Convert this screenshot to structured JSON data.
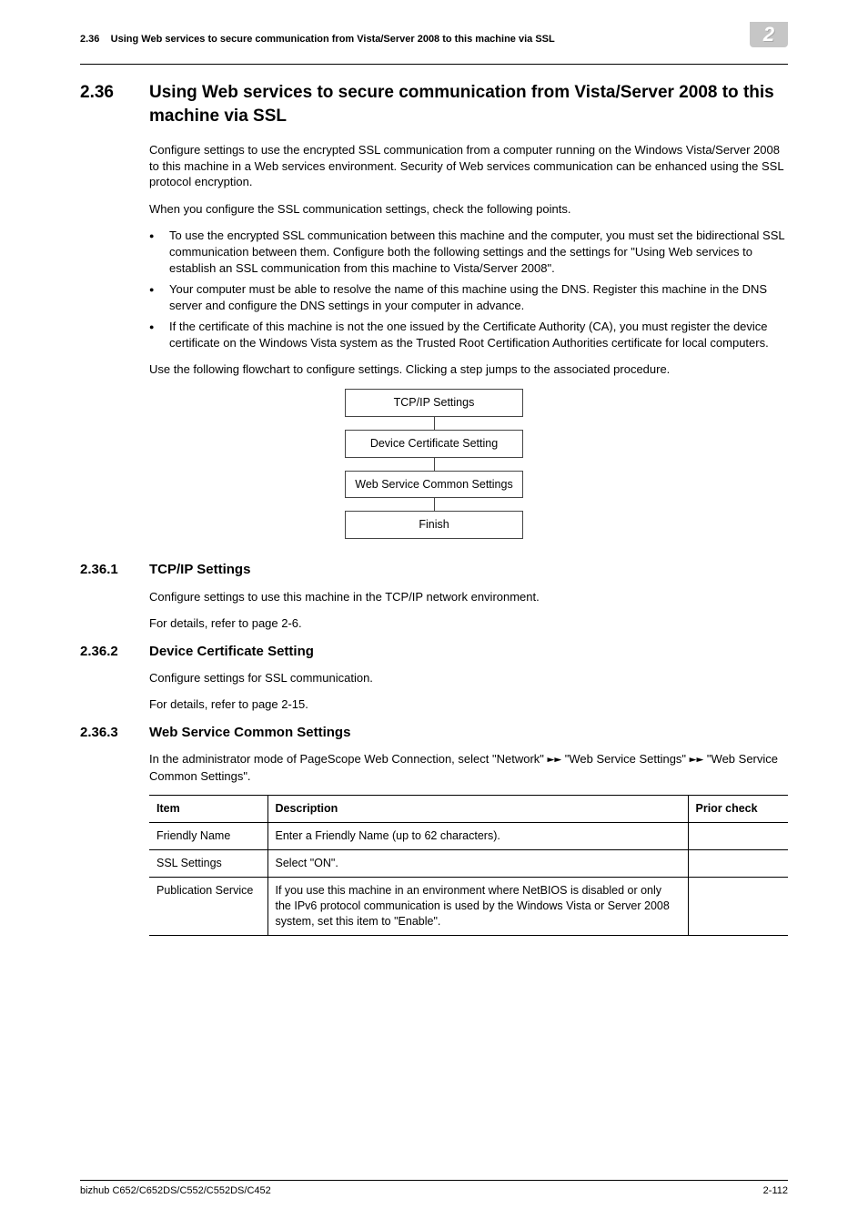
{
  "running_head": {
    "section_num": "2.36",
    "title": "Using Web services to secure communication from Vista/Server 2008 to this machine via SSL",
    "chapter": "2"
  },
  "h1": {
    "num": "2.36",
    "title": "Using Web services to secure communication from Vista/Server 2008 to this machine via SSL"
  },
  "intro_p1": "Configure settings to use the encrypted SSL communication from a computer running on the Windows Vista/Server 2008 to this machine in a Web services environment. Security of Web services communication can be enhanced using the SSL protocol encryption.",
  "intro_p2": "When you configure the SSL communication settings, check the following points.",
  "bullets": [
    "To use the encrypted SSL communication between this machine and the computer, you must set the bidirectional SSL communication between them. Configure both the following settings and the settings for \"Using Web services to establish an SSL communication from this machine to Vista/Server 2008\".",
    "Your computer must be able to resolve the name of this machine using the DNS. Register this machine in the DNS server and configure the DNS settings in your computer in advance.",
    "If the certificate of this machine is not the one issued by the Certificate Authority (CA), you must register the device certificate on the Windows Vista system as the Trusted Root Certification Authorities certificate for local computers."
  ],
  "flow_intro": "Use the following flowchart to configure settings. Clicking a step jumps to the associated procedure.",
  "flow": {
    "step1": "TCP/IP Settings",
    "step2": "Device Certificate Setting",
    "step3": "Web Service Common Settings",
    "finish": "Finish"
  },
  "sec1": {
    "num": "2.36.1",
    "title": "TCP/IP Settings",
    "p1": "Configure settings to use this machine in the TCP/IP network environment.",
    "p2": "For details, refer to page 2-6."
  },
  "sec2": {
    "num": "2.36.2",
    "title": "Device Certificate Setting",
    "p1": "Configure settings for SSL communication.",
    "p2": "For details, refer to page 2-15."
  },
  "sec3": {
    "num": "2.36.3",
    "title": "Web Service Common Settings",
    "p1_a": "In the administrator mode of PageScope Web Connection, select \"Network\" ",
    "p1_b": " \"Web Service Settings\" ",
    "p1_c": " \"Web Service Common Settings\".",
    "table": {
      "headers": {
        "c1": "Item",
        "c2": "Description",
        "c3": "Prior check"
      },
      "rows": [
        {
          "c1": "Friendly Name",
          "c2": "Enter a Friendly Name (up to 62 characters).",
          "c3": ""
        },
        {
          "c1": "SSL Settings",
          "c2": "Select \"ON\".",
          "c3": ""
        },
        {
          "c1": "Publication Service",
          "c2": "If you use this machine in an environment where NetBIOS is disabled or only the IPv6 protocol communication is used by the Windows Vista or Server 2008 system, set this item to \"Enable\".",
          "c3": ""
        }
      ]
    }
  },
  "footer": {
    "left": "bizhub C652/C652DS/C552/C552DS/C452",
    "right": "2-112"
  }
}
